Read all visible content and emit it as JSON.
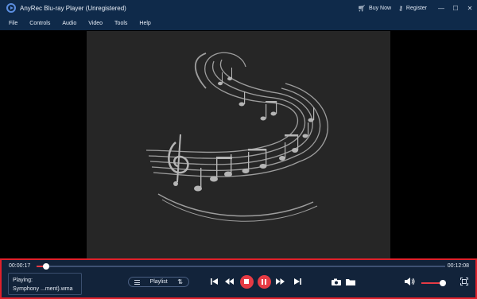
{
  "window": {
    "title": "AnyRec Blu-ray Player (Unregistered)",
    "buy_now": "Buy Now",
    "register": "Register",
    "logo_icon": "anyrec-play-logo-icon"
  },
  "menu": {
    "items": [
      "File",
      "Controls",
      "Audio",
      "Video",
      "Tools",
      "Help"
    ]
  },
  "player": {
    "artwork": "music-notes-swirl-artwork",
    "current_time": "00:00:17",
    "total_time": "00:12:08",
    "progress": 0.023,
    "now_playing_label": "Playing:",
    "now_playing_file": "Symphony ...ment).wma",
    "playlist_label": "Playlist",
    "volume": 0.9
  },
  "colors": {
    "titlebar": "#0f2a4a",
    "controls_bg": "#12233a",
    "accent_red": "#e63b45",
    "highlight_border": "#e0202a"
  }
}
